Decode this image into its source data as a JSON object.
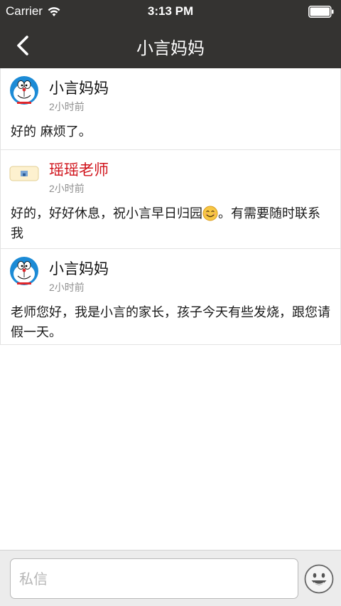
{
  "status_bar": {
    "carrier": "Carrier",
    "time": "3:13 PM",
    "wifi_icon": "wifi-icon",
    "battery_icon": "battery-icon"
  },
  "nav": {
    "title": "小言妈妈",
    "back_icon": "chevron-left-icon",
    "background": "#343331"
  },
  "messages": [
    {
      "sender": "小言妈妈",
      "avatar": "doraemon-avatar",
      "time": "2小时前",
      "body": "好的 麻烦了。"
    },
    {
      "sender": "瑶瑶老师",
      "sender_color": "#d0131b",
      "avatar": "teacher-avatar",
      "time": "2小时前",
      "body_before_emoji": "好的，好好休息，祝小言早日归园",
      "emoji": "smiling-face-icon",
      "body_after_emoji": "。有需要随时联系我"
    },
    {
      "sender": "小言妈妈",
      "avatar": "doraemon-avatar",
      "time": "2小时前",
      "body": "老师您好，我是小言的家长，孩子今天有些发烧，跟您请假一天。"
    }
  ],
  "input_bar": {
    "placeholder": "私信",
    "value": "",
    "emoji_button_icon": "smiley-icon"
  }
}
